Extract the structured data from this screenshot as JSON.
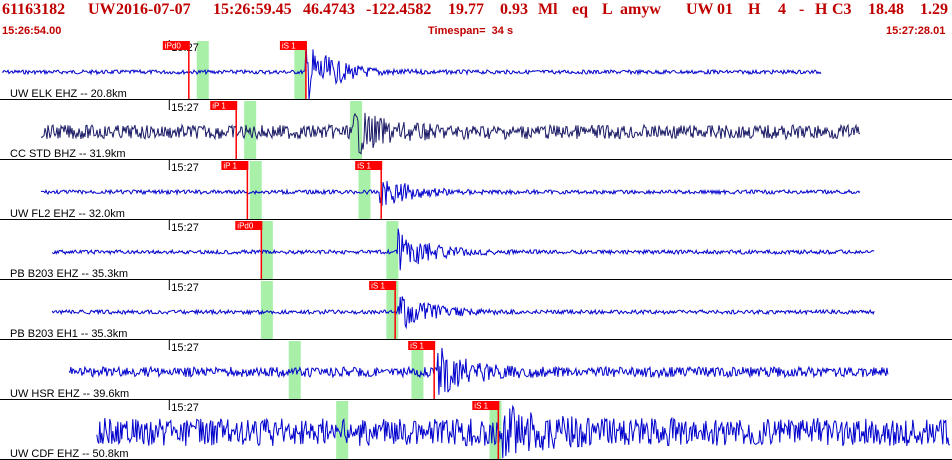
{
  "header": {
    "event_id": "61163182",
    "network": "UW",
    "date": "2016-07-07",
    "time": "15:26:59.45",
    "lat": "46.4743",
    "lon": "-122.4582",
    "depth": "19.77",
    "magnitude": "0.93",
    "mag_type": "Ml",
    "event_type": "eq",
    "status": "L",
    "analyst": "amyw",
    "source": "UW",
    "version": "01",
    "quality": "H",
    "count": "4",
    "dash": "-",
    "flag": "H",
    "cls": "C3",
    "rms": "18.48",
    "err": "1.29"
  },
  "subheader": {
    "start_time": "15:26:54.00",
    "timespan": "Timespan=  34 s",
    "end_time": "15:27:28.01"
  },
  "colors": {
    "header_red": "#c00000",
    "trace_blue": "#0000cc",
    "trace_navy": "#1a1a66",
    "pick_red": "#ff0000",
    "window_green": "#a8f0a8"
  },
  "start_seconds": 0,
  "span_seconds": 34,
  "traces": [
    {
      "label": "UW ELK EHZ -- 20.8km",
      "minute": "15:27",
      "color": "navy",
      "amp": 2,
      "picks": [
        {
          "label": "iPd0",
          "t": 6.7
        },
        {
          "label": "iS 1",
          "t": 10.9
        }
      ],
      "windows": [
        {
          "t": 7.2
        },
        {
          "t": 10.7
        }
      ],
      "burst_t": 10.9,
      "burst_amp": 30,
      "data_start": 0,
      "data_end": 29.4
    },
    {
      "label": "CC STD BHZ -- 31.9km",
      "minute": "15:27",
      "color": "dark",
      "amp": 7,
      "picks": [
        {
          "label": "iP 1",
          "t": 8.4
        }
      ],
      "windows": [
        {
          "t": 8.9
        },
        {
          "t": 12.7
        }
      ],
      "burst_t": 12.6,
      "burst_amp": 20,
      "data_start": 1.4,
      "data_end": 30.8
    },
    {
      "label": "UW FL2 EHZ -- 32.0km",
      "minute": "15:27",
      "color": "blue",
      "amp": 2,
      "picks": [
        {
          "label": "iP 1",
          "t": 8.8
        },
        {
          "label": "iS 1",
          "t": 13.6
        }
      ],
      "windows": [
        {
          "t": 9.1
        },
        {
          "t": 13.0
        }
      ],
      "burst_t": 13.5,
      "burst_amp": 18,
      "data_start": 1.4,
      "data_end": 30.8
    },
    {
      "label": "PB B203 EHZ -- 35.3km",
      "minute": "15:27",
      "color": "blue",
      "amp": 2,
      "picks": [
        {
          "label": "iPd0",
          "t": 9.3
        }
      ],
      "windows": [
        {
          "t": 9.5
        },
        {
          "t": 14.0
        }
      ],
      "burst_t": 14.2,
      "burst_amp": 22,
      "data_start": 1.8,
      "data_end": 31.3
    },
    {
      "label": "PB B203 EH1 -- 35.3km",
      "minute": "15:27",
      "color": "blue",
      "amp": 2,
      "picks": [
        {
          "label": "iS 1",
          "t": 14.1
        }
      ],
      "windows": [
        {
          "t": 9.5
        },
        {
          "t": 14.0
        }
      ],
      "burst_t": 14.2,
      "burst_amp": 20,
      "data_start": 1.8,
      "data_end": 31.3
    },
    {
      "label": "UW HSR EHZ -- 39.6km",
      "minute": "15:27",
      "color": "blue",
      "amp": 5,
      "picks": [
        {
          "label": "iS 1",
          "t": 15.5
        }
      ],
      "windows": [
        {
          "t": 10.5
        },
        {
          "t": 14.9
        }
      ],
      "burst_t": 15.6,
      "burst_amp": 25,
      "data_start": 2.4,
      "data_end": 31.8
    },
    {
      "label": "UW CDF EHZ -- 50.8km",
      "minute": "15:27",
      "color": "blue",
      "amp": 14,
      "picks": [
        {
          "label": "iS 1",
          "t": 17.8
        }
      ],
      "windows": [
        {
          "t": 12.2
        },
        {
          "t": 17.7
        }
      ],
      "burst_t": 17.9,
      "burst_amp": 20,
      "data_start": 3.4,
      "data_end": 34
    }
  ]
}
